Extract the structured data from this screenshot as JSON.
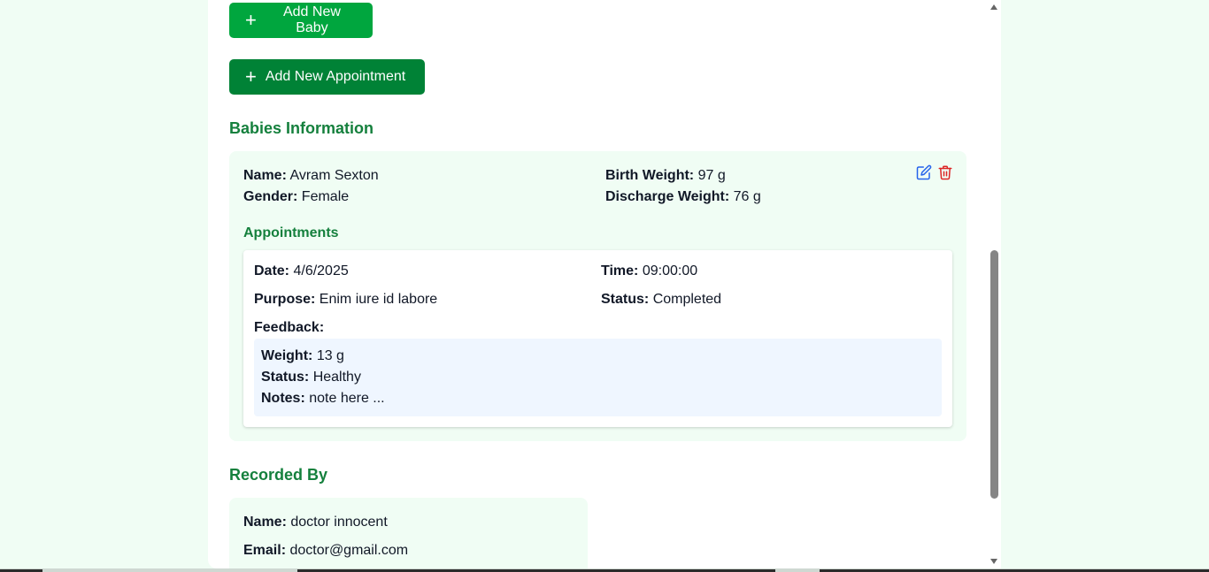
{
  "actions": {
    "add_baby_label": "Add New Baby",
    "add_appointment_label": "Add New Appointment"
  },
  "babies_section": {
    "title": "Babies Information",
    "baby": {
      "name_label": "Name:",
      "name": "Avram Sexton",
      "gender_label": "Gender:",
      "gender": "Female",
      "birth_weight_label": "Birth Weight:",
      "birth_weight": "97 g",
      "discharge_weight_label": "Discharge Weight:",
      "discharge_weight": "76 g"
    },
    "appointments_title": "Appointments",
    "appointment": {
      "date_label": "Date:",
      "date": "4/6/2025",
      "time_label": "Time:",
      "time": "09:00:00",
      "purpose_label": "Purpose:",
      "purpose": "Enim iure id labore",
      "status_label": "Status:",
      "status": "Completed",
      "feedback_label": "Feedback:",
      "feedback": {
        "weight_label": "Weight:",
        "weight": "13 g",
        "status_label": "Status:",
        "status": "Healthy",
        "notes_label": "Notes:",
        "notes": "note here ..."
      }
    }
  },
  "recorded_by": {
    "title": "Recorded By",
    "name_label": "Name:",
    "name": "doctor innocent",
    "email_label": "Email:",
    "email": "doctor@gmail.com"
  },
  "icons": {
    "add": "plus-icon",
    "edit": "edit-icon",
    "delete": "trash-icon"
  },
  "colors": {
    "page_bg": "#f0fdf4",
    "primary_green": "#00a63e",
    "dark_green": "#008236",
    "heading_green": "#15803d",
    "edit_blue": "#2563eb",
    "delete_red": "#dc2626",
    "feedback_bg": "#eff6ff"
  }
}
